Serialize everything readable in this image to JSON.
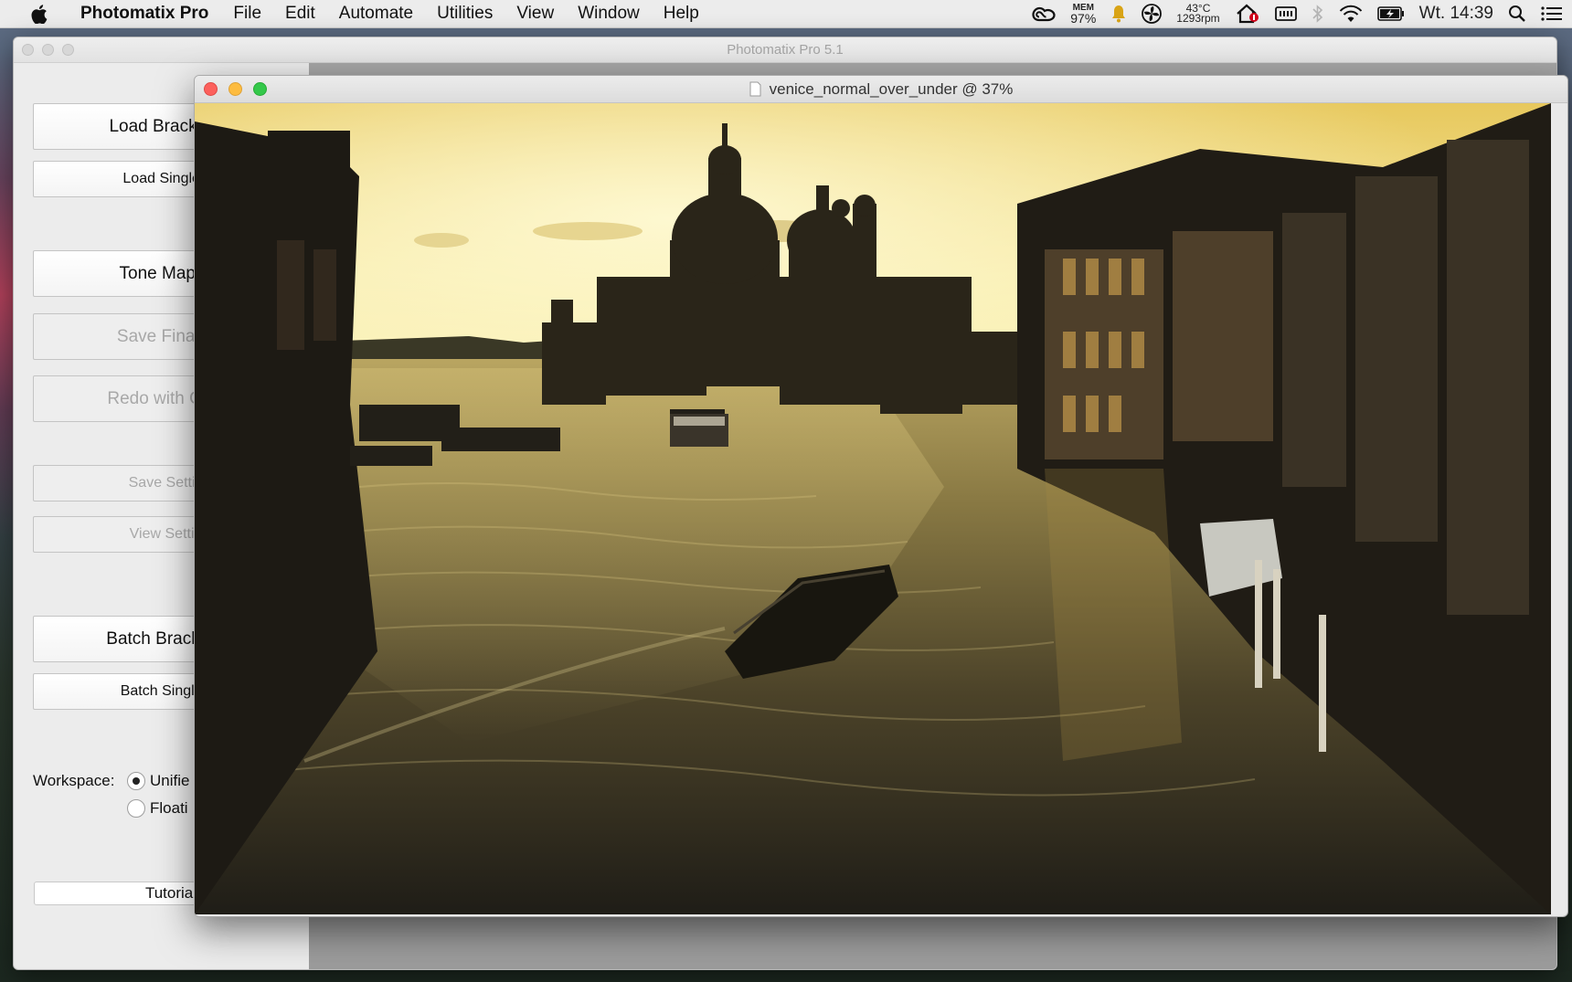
{
  "menubar": {
    "app_name": "Photomatix Pro",
    "items": [
      "File",
      "Edit",
      "Automate",
      "Utilities",
      "View",
      "Window",
      "Help"
    ],
    "status": {
      "mem_label": "MEM",
      "mem_value": "97%",
      "temp": "43°C",
      "fan": "1293rpm",
      "clock": "Wt. 14:39"
    }
  },
  "main_window": {
    "title": "Photomatix Pro 5.1",
    "buttons": {
      "load_bracketed": "Load Bracketed",
      "load_single": "Load Single Pl",
      "tone_map": "Tone Map / F",
      "save_final": "Save Final Im",
      "redo": "Redo with Other",
      "save_settings": "Save Setting",
      "view_settings": "View Setting",
      "batch_bracketed": "Batch Bracketed",
      "batch_single": "Batch Single Pl"
    },
    "workspace": {
      "label": "Workspace:",
      "option_unified": "Unifie",
      "option_floating": "Floati",
      "selected": "Unifie"
    },
    "tutorial": "Tutorial"
  },
  "image_window": {
    "title": "venice_normal_over_under @ 37%"
  },
  "colors": {
    "sky_top": "#f1d97a",
    "sky_bottom": "#fdf6c0",
    "water": "#5a4f2b",
    "silhouette": "#1d1a14"
  }
}
